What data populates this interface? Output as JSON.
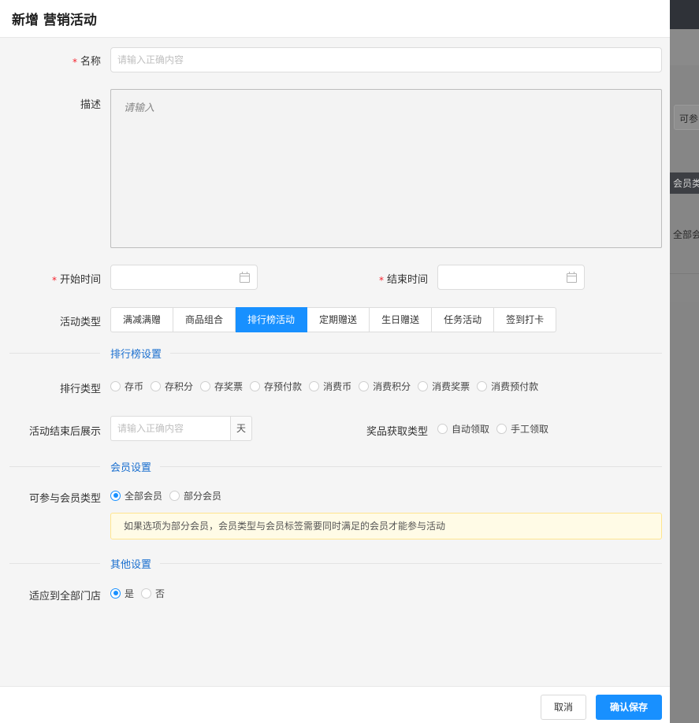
{
  "drawer": {
    "title": "新增 营销活动"
  },
  "form": {
    "name": {
      "label": "名称",
      "placeholder": "请输入正确内容",
      "required_mark": "*"
    },
    "description": {
      "label": "描述",
      "placeholder": "请输入"
    },
    "start_time": {
      "label": "开始时间",
      "required_mark": "*"
    },
    "end_time": {
      "label": "结束时间",
      "required_mark": "*"
    },
    "activity_type": {
      "label": "活动类型",
      "options": [
        "满减满赠",
        "商品组合",
        "排行榜活动",
        "定期赠送",
        "生日赠送",
        "任务活动",
        "签到打卡"
      ],
      "selected": "排行榜活动"
    }
  },
  "ranking_section": {
    "title": "排行榜设置",
    "rank_type": {
      "label": "排行类型",
      "options": [
        "存币",
        "存积分",
        "存奖票",
        "存预付款",
        "消费币",
        "消费积分",
        "消费奖票",
        "消费预付款"
      ]
    },
    "post_display": {
      "label": "活动结束后展示",
      "placeholder": "请输入正确内容",
      "unit": "天"
    },
    "prize_type": {
      "label": "奖品获取类型",
      "options": [
        "自动领取",
        "手工领取"
      ]
    }
  },
  "member_section": {
    "title": "会员设置",
    "member_type": {
      "label": "可参与会员类型",
      "options": [
        "全部会员",
        "部分会员"
      ],
      "selected": "全部会员"
    },
    "notice": "如果选项为部分会员，会员类型与会员标签需要同时满足的会员才能参与活动"
  },
  "other_section": {
    "title": "其他设置",
    "all_stores": {
      "label": "适应到全部门店",
      "options": [
        "是",
        "否"
      ],
      "selected": "是"
    }
  },
  "footer": {
    "cancel_label": "取消",
    "confirm_label": "确认保存"
  },
  "backdrop": {
    "partial_texts": [
      "可参",
      "会员类",
      "全部会"
    ]
  },
  "colors": {
    "primary": "#1890ff",
    "required": "#f5222d",
    "section_title": "#1a6fcf",
    "notice_bg": "#fffbe6",
    "notice_border": "#ffe58f"
  }
}
